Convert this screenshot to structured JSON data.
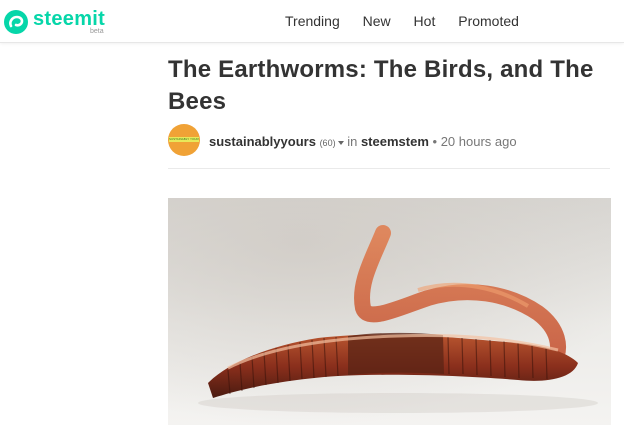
{
  "header": {
    "logo_text": "steemit",
    "logo_sub": "beta",
    "nav": [
      "Trending",
      "New",
      "Hot",
      "Promoted"
    ],
    "accent": "#06d6a9"
  },
  "post": {
    "title": "The Earthworms: The Birds, and The Bees",
    "author": "sustainablyyours",
    "reputation": "(60)",
    "in_label": "in",
    "community": "steemstem",
    "separator": "•",
    "time_ago": "20 hours ago",
    "avatar_badge": "SUSTAINABLY YOURS",
    "hero_image": "earthworm-closeup"
  }
}
